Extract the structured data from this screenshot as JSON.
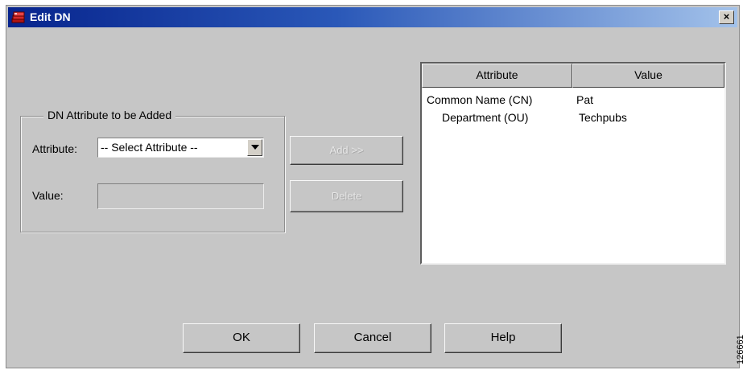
{
  "window": {
    "title": "Edit DN",
    "close_label": "×"
  },
  "group": {
    "legend": "DN Attribute to be Added",
    "attribute_label": "Attribute:",
    "attribute_selected": "-- Select Attribute --",
    "value_label": "Value:",
    "value_input": ""
  },
  "buttons": {
    "add": "Add >>",
    "delete": "Delete",
    "ok": "OK",
    "cancel": "Cancel",
    "help": "Help"
  },
  "table": {
    "headers": [
      "Attribute",
      "Value"
    ],
    "rows": [
      {
        "attribute": "Common Name (CN)",
        "value": "Pat"
      },
      {
        "attribute": "Department (OU)",
        "value": "Techpubs"
      }
    ]
  },
  "side_note": "126661",
  "colors": {
    "dialog_bg": "#c6c6c6",
    "titlebar_start": "#07248d",
    "titlebar_end": "#a3c2ea"
  },
  "icons": {
    "app": "red-stack-icon",
    "dropdown": "chevron-down-icon",
    "close": "close-icon"
  }
}
